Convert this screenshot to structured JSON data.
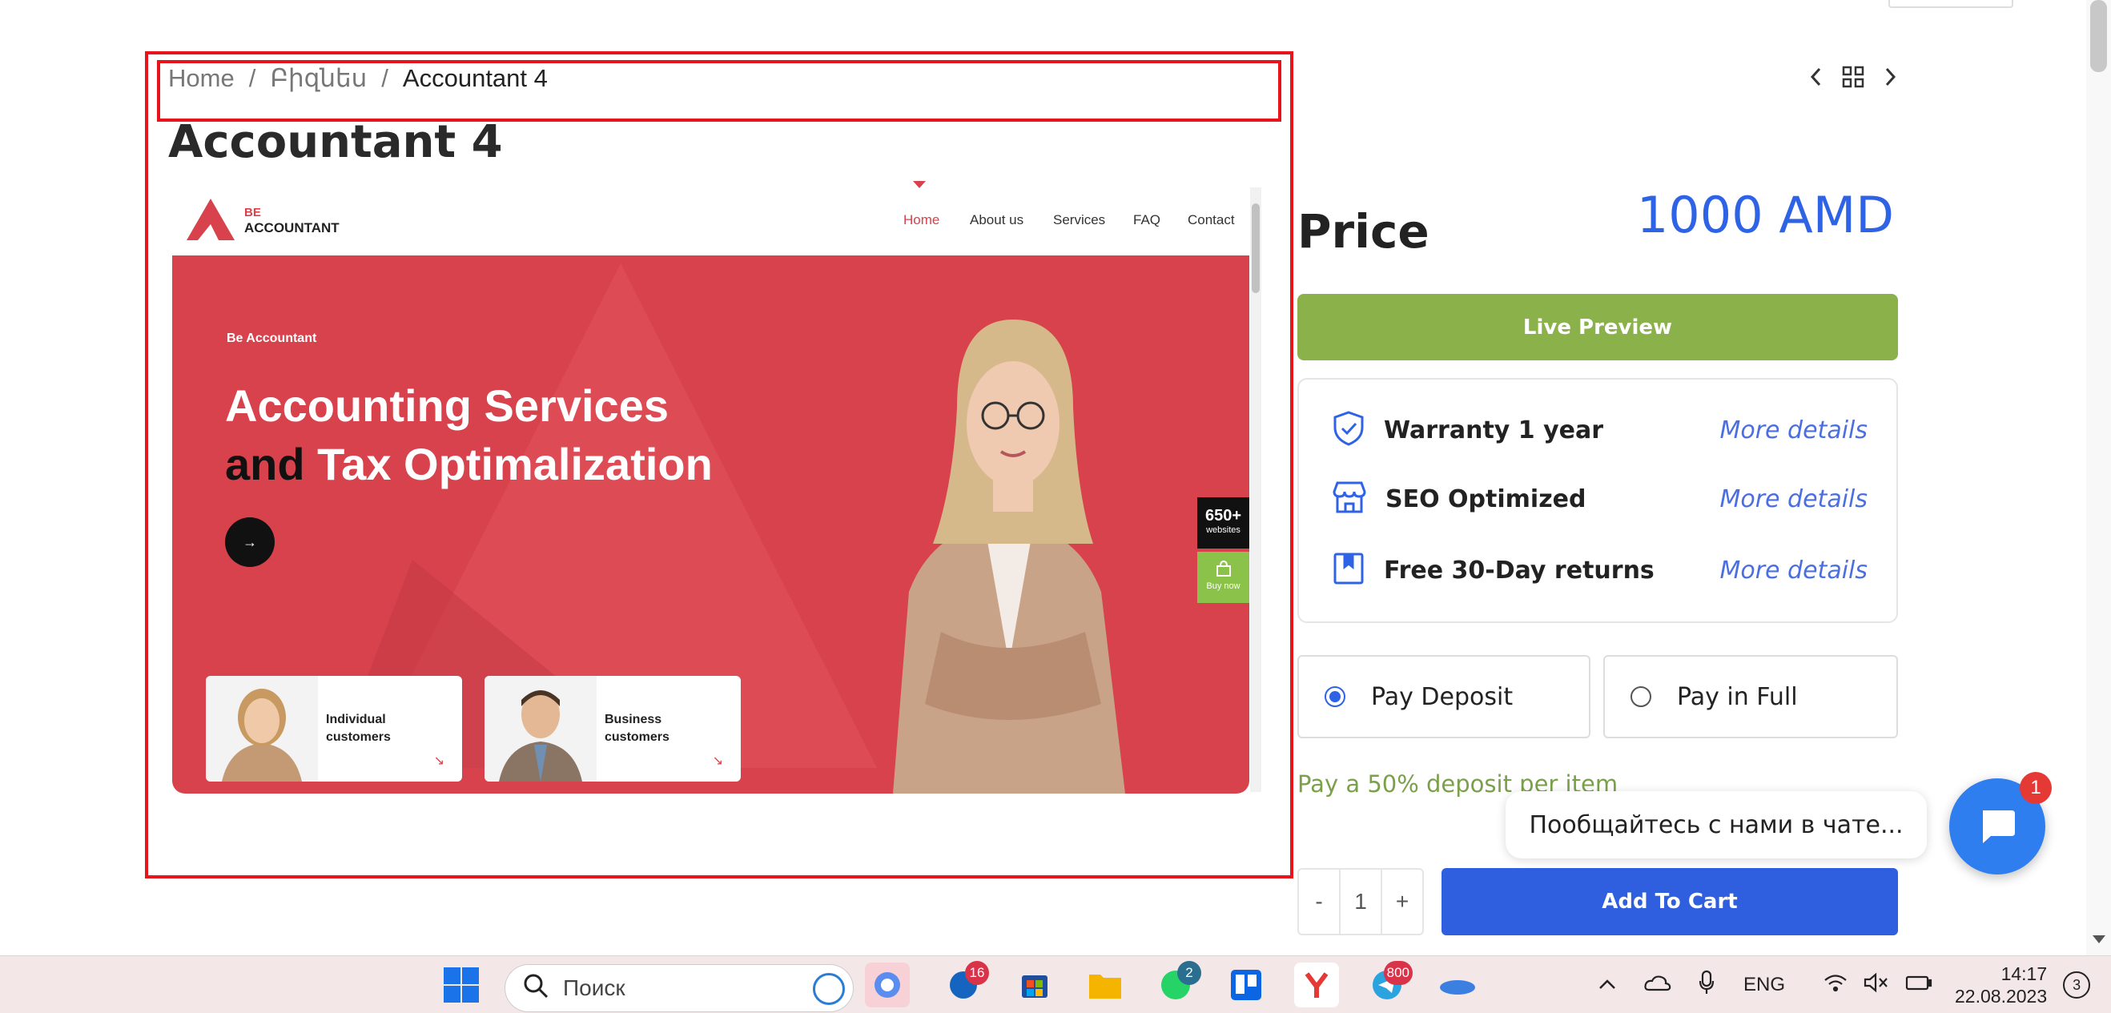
{
  "breadcrumb": {
    "home": "Home",
    "sep1": "/",
    "category": "Բիզնես",
    "sep2": "/",
    "current": "Accountant 4"
  },
  "page_title": "Accountant 4",
  "preview": {
    "logo_line1": "BE",
    "logo_line2": "ACCOUNTANT",
    "menu": [
      "Home",
      "About us",
      "Services",
      "FAQ",
      "Contact"
    ],
    "eyebrow": "Be Accountant",
    "headline_1": "Accounting Services",
    "headline_2a": "and",
    "headline_2b": "Tax Optimalization",
    "side_count": "650+",
    "side_count_sub": "websites",
    "side_buy": "Buy now",
    "card1": "Individual customers",
    "card2": "Business customers"
  },
  "price": {
    "label": "Price",
    "value": "1000 AMD"
  },
  "live_preview_label": "Live Preview",
  "features": [
    {
      "icon": "shield-check-icon",
      "text": "Warranty 1 year",
      "link": "More details"
    },
    {
      "icon": "storefront-icon",
      "text": "SEO Optimized",
      "link": "More details"
    },
    {
      "icon": "bookmark-box-icon",
      "text": "Free 30-Day returns",
      "link": "More details"
    }
  ],
  "payment": {
    "deposit": "Pay Deposit",
    "full": "Pay in Full",
    "selected": "deposit",
    "note": "Pay a 50% deposit per item"
  },
  "quantity": {
    "minus": "-",
    "value": "1",
    "plus": "+"
  },
  "add_to_cart": "Add To Cart",
  "chat": {
    "prompt": "Пообщайтесь с нами в чате...",
    "badge": "1"
  },
  "taskbar": {
    "search_placeholder": "Поиск",
    "badges": {
      "mail": "16",
      "whatsapp": "2",
      "telegram": "800"
    },
    "lang": "ENG",
    "time": "14:17",
    "date": "22.08.2023",
    "notifications": "3"
  },
  "colors": {
    "accent_blue": "#2f63e6",
    "live_green": "#8bb24a",
    "hero_red": "#d8424c",
    "highlight_red": "#e8141c"
  }
}
